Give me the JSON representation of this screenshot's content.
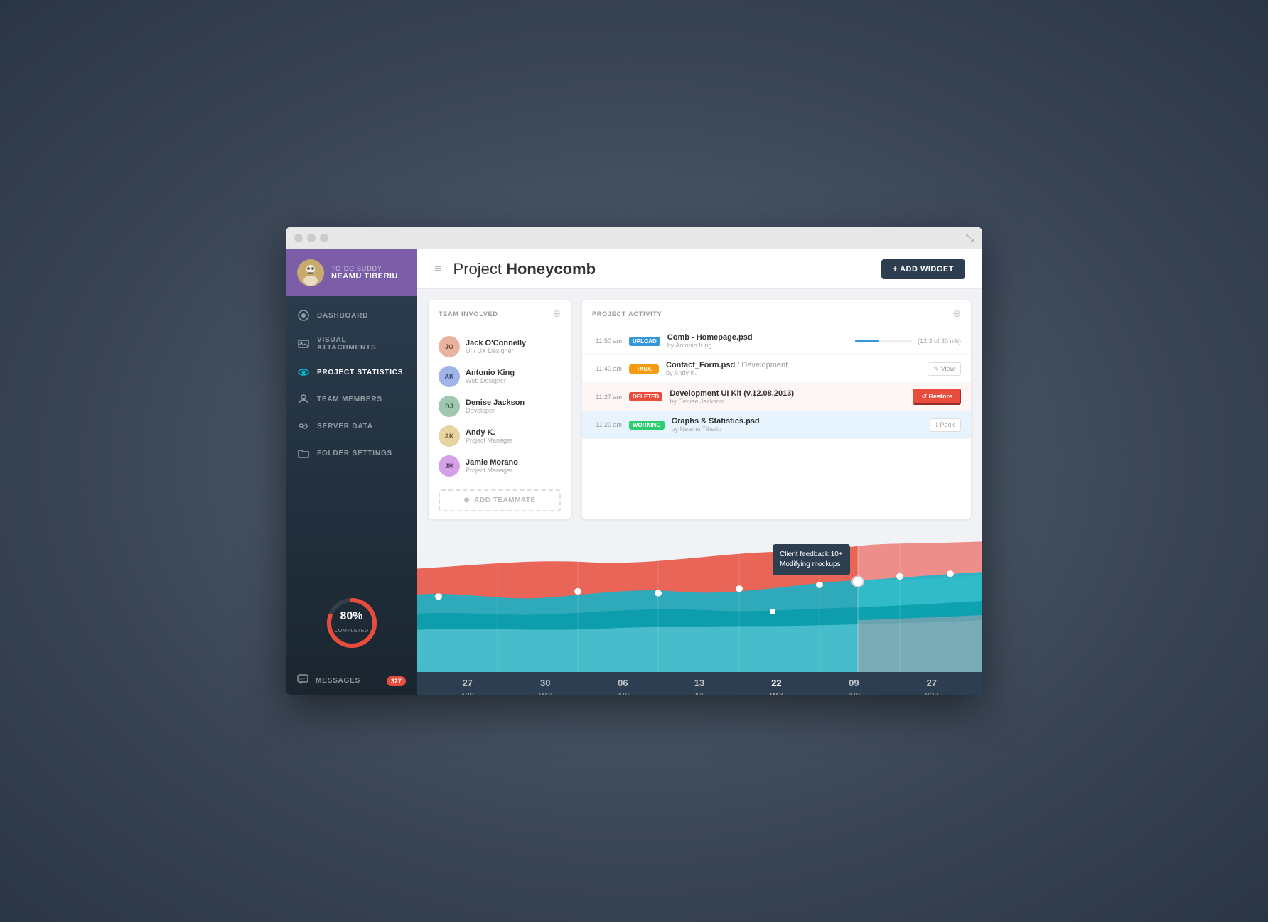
{
  "app": {
    "name": "TO-DO BUDDY",
    "user": "NEAMU TIBERIU"
  },
  "nav": {
    "items": [
      {
        "id": "dashboard",
        "label": "DASHBOARD",
        "icon": "circle"
      },
      {
        "id": "visual-attachments",
        "label": "VISUAL ATTACHMENTS",
        "icon": "image"
      },
      {
        "id": "project-statistics",
        "label": "PROJECT STATISTICS",
        "icon": "eye",
        "active": true
      },
      {
        "id": "team-members",
        "label": "TEAM MEMBERS",
        "icon": "person"
      },
      {
        "id": "server-data",
        "label": "SERVER DATA",
        "icon": "infinity"
      },
      {
        "id": "folder-settings",
        "label": "FOLDER SETTINGS",
        "icon": "folder"
      }
    ],
    "messages_label": "MESSAGES",
    "messages_count": "327"
  },
  "progress": {
    "percent": "80%",
    "label": "COMPLETED",
    "value": 80
  },
  "header": {
    "title_light": "Project ",
    "title_bold": "Honeycomb",
    "add_widget_label": "+ ADD WIDGET",
    "menu_icon": "≡"
  },
  "team_widget": {
    "title": "TEAM INVOLVED",
    "members": [
      {
        "name": "Jack O'Connelly",
        "role": "UI / UX Designer",
        "initials": "JO",
        "color": "#e8b4a0"
      },
      {
        "name": "Antonio King",
        "role": "Web Designer",
        "initials": "AK",
        "color": "#a0b4e8"
      },
      {
        "name": "Denise Jackson",
        "role": "Developer",
        "initials": "DJ",
        "color": "#a0e8b4"
      },
      {
        "name": "Andy K.",
        "role": "Project Manager",
        "initials": "AK",
        "color": "#e8d4a0"
      },
      {
        "name": "Jamie Morano",
        "role": "Project Manager",
        "initials": "JM",
        "color": "#d4a0e8"
      }
    ],
    "add_button": "ADD TEAMMATE"
  },
  "activity_widget": {
    "title": "PROJECT ACTIVITY",
    "items": [
      {
        "time": "11:50 am",
        "badge": "UPLOAD",
        "badge_type": "upload",
        "filename": "Comb - Homepage.psd",
        "by": "by Antonio King",
        "progress": 41,
        "size": "(12.3 of 30 mb)",
        "action": null
      },
      {
        "time": "11:40 am",
        "badge": "TASK",
        "badge_type": "task",
        "filename": "Contact_Form.psd",
        "filename_extra": " / Development",
        "by": "by Andy K.",
        "action": "View",
        "action_icon": "✎"
      },
      {
        "time": "11:27 am",
        "badge": "DELETED",
        "badge_type": "deleted",
        "filename": "Development UI Kit (v.12.08.2013)",
        "by": "by Denise Jackson",
        "action": "Restore",
        "action_type": "restore",
        "action_icon": "↺"
      },
      {
        "time": "11:20 am",
        "badge": "WORKING",
        "badge_type": "working",
        "filename": "Graphs & Statistics.psd",
        "by": "by Neamu Tiberiu",
        "action": "Peek",
        "action_icon": "ℹ"
      }
    ]
  },
  "chart": {
    "tooltip_text": "Client feedback 10+\nModifying mockups"
  },
  "timeline": {
    "items": [
      {
        "date": "27",
        "month": "APR"
      },
      {
        "date": "30",
        "month": "MAY"
      },
      {
        "date": "06",
        "month": "JUN"
      },
      {
        "date": "13",
        "month": "JUL"
      },
      {
        "date": "22",
        "month": "MAY"
      },
      {
        "date": "09",
        "month": "JUN"
      },
      {
        "date": "27",
        "month": "NOV"
      }
    ]
  }
}
